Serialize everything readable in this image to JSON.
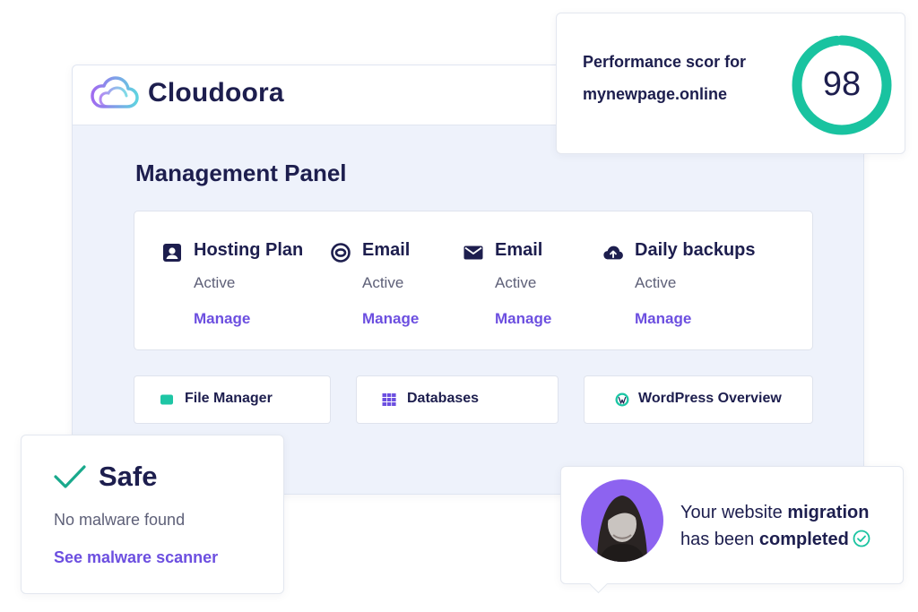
{
  "brand": {
    "name": "Cloudoora",
    "logo_icon": "cloud-logo-icon",
    "colors": {
      "gradient_start": "#a06bf0",
      "gradient_end": "#5fd3e0"
    }
  },
  "panel": {
    "title": "Management Panel",
    "services": [
      {
        "title": "Hosting Plan",
        "status": "Active",
        "action": "Manage",
        "icon": "user-card-icon"
      },
      {
        "title": "Email",
        "status": "Active",
        "action": "Manage",
        "icon": "at-sign-icon"
      },
      {
        "title": "Email",
        "status": "Active",
        "action": "Manage",
        "icon": "envelope-icon"
      },
      {
        "title": "Daily backups",
        "status": "Active",
        "action": "Manage",
        "icon": "cloud-upload-icon"
      }
    ],
    "tools": [
      {
        "label": "File Manager",
        "icon": "folder-icon",
        "icon_color": "#1ec6a5"
      },
      {
        "label": "Databases",
        "icon": "grid-icon",
        "icon_color": "#6c4fe0"
      },
      {
        "label": "WordPress Overview",
        "icon": "wordpress-icon",
        "icon_color": "#1ec6a5"
      }
    ]
  },
  "performance": {
    "line1": "Performance scor for",
    "line2": "mynewpage.online",
    "score": "98",
    "score_fraction": 0.98,
    "ring_color": "#19c3a0"
  },
  "security": {
    "title": "Safe",
    "status": "No malware found",
    "link": "See malware scanner",
    "check_color": "#19a98c"
  },
  "migration": {
    "line1_prefix": "Your website ",
    "line1_bold": "migration",
    "line2_prefix": "has been ",
    "line2_bold": "completed",
    "avatar_bg": "#8d63f0"
  },
  "colors": {
    "accent": "#6c4fe0",
    "text": "#1d1e4e",
    "muted": "#5e6078",
    "panel_bg": "#eef2fb"
  }
}
